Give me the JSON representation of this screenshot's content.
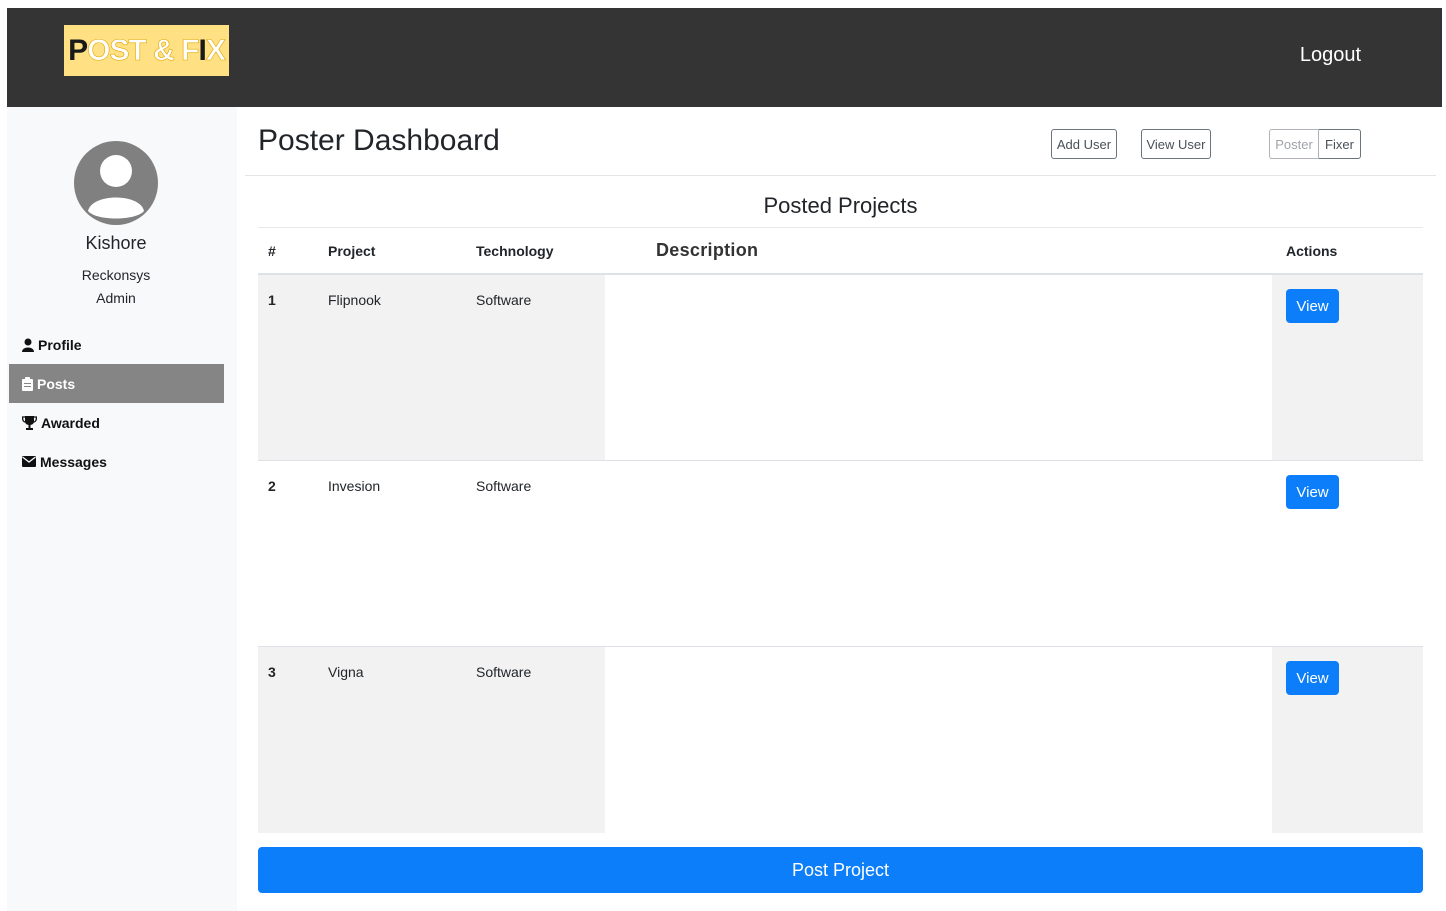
{
  "header": {
    "logo_text": "POST & FIX",
    "logout_label": "Logout"
  },
  "sidebar": {
    "user_name": "Kishore",
    "user_org": "Reckonsys",
    "user_role": "Admin",
    "items": [
      {
        "label": "Profile",
        "icon": "user-icon",
        "active": false
      },
      {
        "label": "Posts",
        "icon": "clipboard-icon",
        "active": true
      },
      {
        "label": "Awarded",
        "icon": "trophy-icon",
        "active": false
      },
      {
        "label": "Messages",
        "icon": "envelope-icon",
        "active": false
      }
    ]
  },
  "main": {
    "title": "Poster Dashboard",
    "add_user_label": "Add User",
    "view_user_label": "View User",
    "toggle": {
      "poster_label": "Poster",
      "fixer_label": "Fixer"
    },
    "section_title": "Posted Projects",
    "columns": {
      "num": "#",
      "project": "Project",
      "technology": "Technology",
      "description": "Description",
      "actions": "Actions"
    },
    "rows": [
      {
        "num": "1",
        "project": "Flipnook",
        "technology": "Software",
        "description": "",
        "action_label": "View"
      },
      {
        "num": "2",
        "project": "Invesion",
        "technology": "Software",
        "description": "",
        "action_label": "View"
      },
      {
        "num": "3",
        "project": "Vigna",
        "technology": "Software",
        "description": "",
        "action_label": "View"
      }
    ],
    "post_project_label": "Post Project"
  }
}
